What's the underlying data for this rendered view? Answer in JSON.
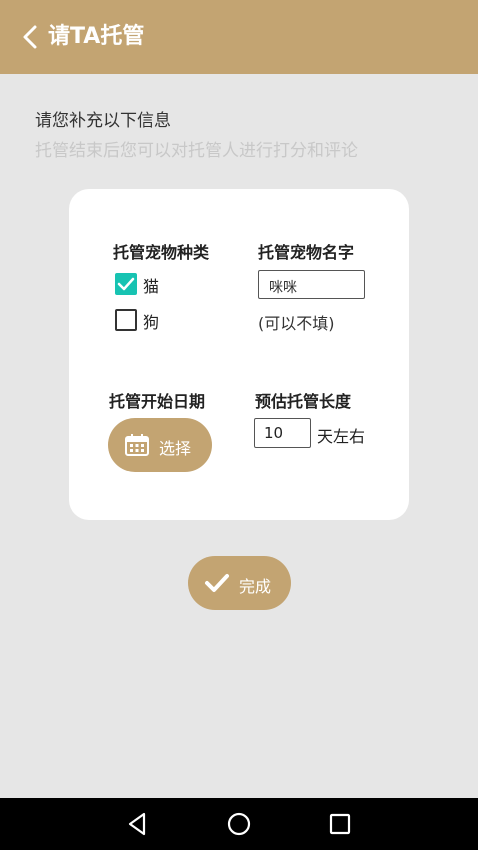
{
  "appbar": {
    "title": "请TA托管",
    "back_icon": "chevron-left-icon"
  },
  "intro": {
    "line1": "请您补充以下信息",
    "line2": "托管结束后您可以对托管人进行打分和评论"
  },
  "form": {
    "pet_type": {
      "label": "托管宠物种类",
      "options": [
        {
          "label": "猫",
          "checked": true
        },
        {
          "label": "狗",
          "checked": false
        }
      ]
    },
    "pet_name": {
      "label": "托管宠物名字",
      "value": "咪咪",
      "hint": "(可以不填)"
    },
    "start_date": {
      "label": "托管开始日期",
      "button_label": "选择",
      "icon": "calendar-icon"
    },
    "duration": {
      "label": "预估托管长度",
      "value": "10",
      "unit": "天左右"
    }
  },
  "done": {
    "label": "完成",
    "icon": "check-icon"
  },
  "navbar": {
    "icons": [
      "back-triangle-icon",
      "home-circle-icon",
      "recents-square-icon"
    ]
  },
  "colors": {
    "accent": "#c3a472",
    "checkbox": "#17c3b2",
    "background": "#e6e6e6"
  }
}
